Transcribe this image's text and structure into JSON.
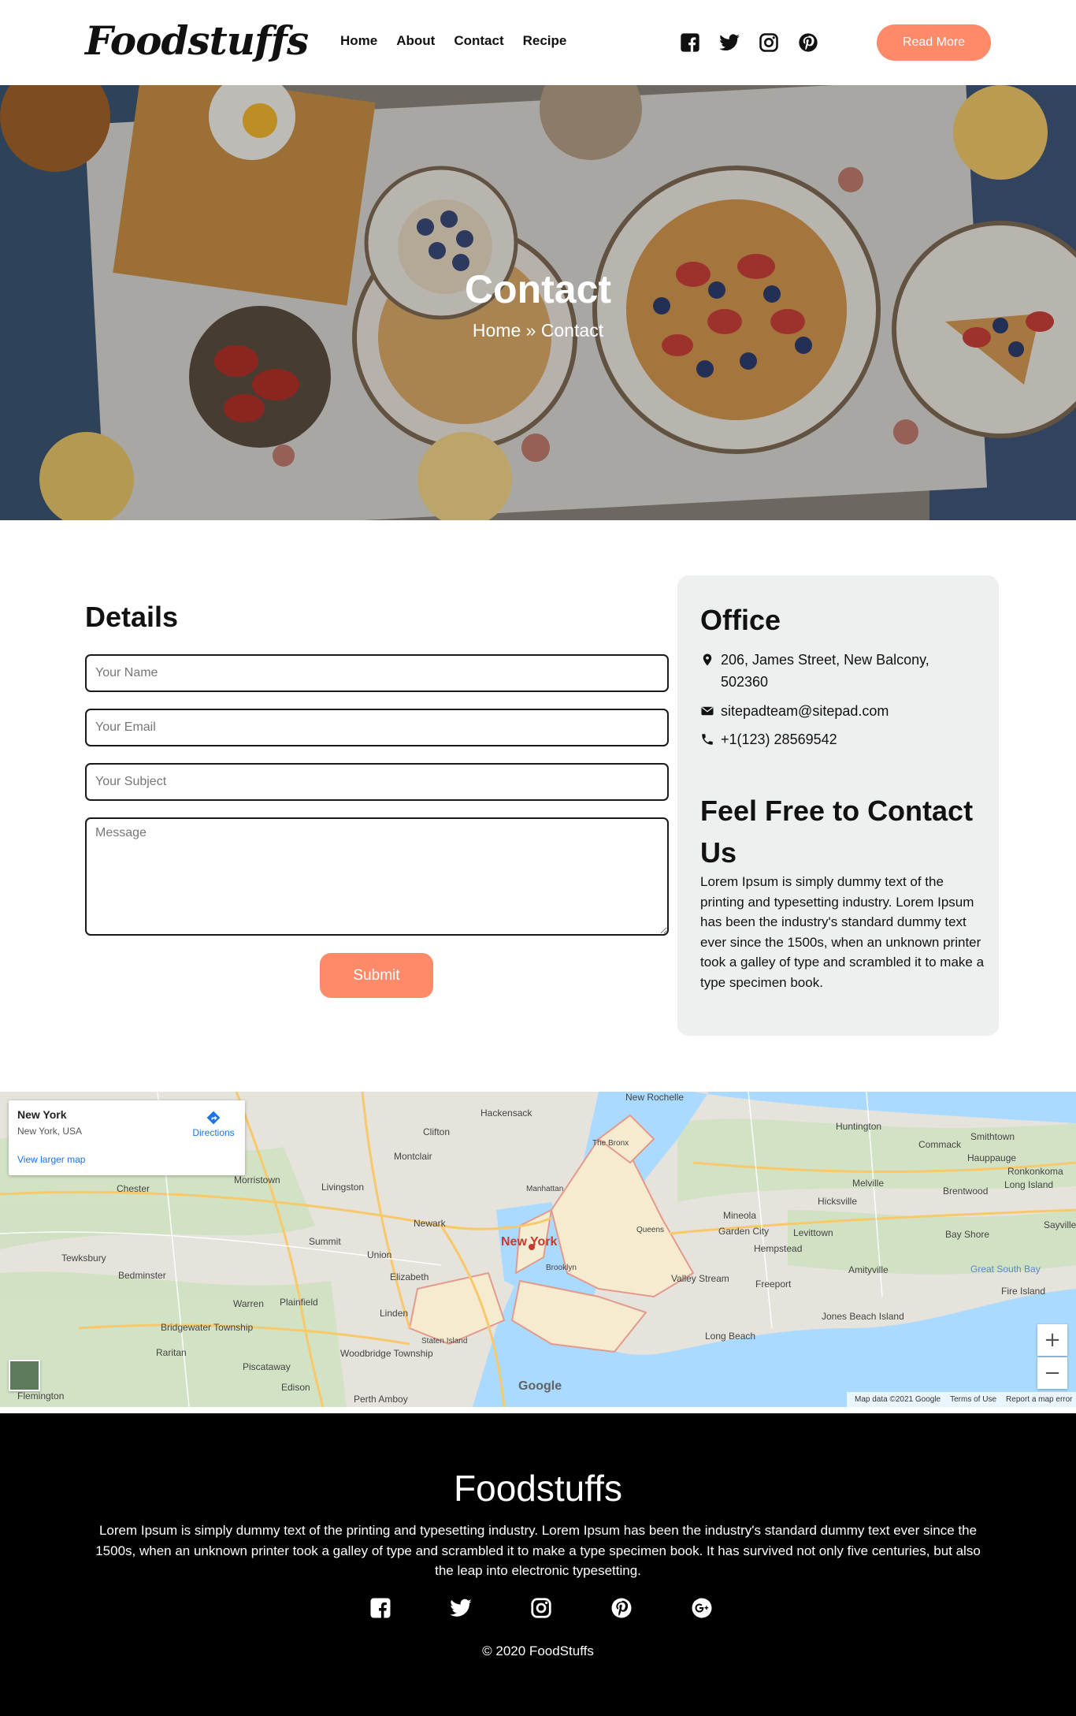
{
  "header": {
    "logo": "Foodstuffs",
    "nav": [
      "Home",
      "About",
      "Contact",
      "Recipe"
    ],
    "socials": [
      "facebook-icon",
      "twitter-icon",
      "instagram-icon",
      "pinterest-icon"
    ],
    "read_more": "Read More"
  },
  "hero": {
    "title": "Contact",
    "breadcrumb": "Home » Contact"
  },
  "form": {
    "title": "Details",
    "name_placeholder": "Your Name",
    "email_placeholder": "Your Email",
    "subject_placeholder": "Your Subject",
    "message_placeholder": "Message",
    "submit": "Submit"
  },
  "office": {
    "title": "Office",
    "address": "206, James Street, New Balcony, 502360",
    "email": "sitepadteam@sitepad.com",
    "phone": "+1(123) 28569542",
    "contact_title": "Feel Free to Contact Us",
    "contact_text": "Lorem Ipsum is simply dummy text of the printing and typesetting industry. Lorem Ipsum has been the industry's standard dummy text ever since the 1500s, when an unknown printer took a galley of type and scrambled it to make a type specimen book."
  },
  "map": {
    "place_title": "New York",
    "place_subtitle": "New York, USA",
    "larger_map": "View larger map",
    "directions": "Directions",
    "city_label": "New York",
    "labels": [
      "Hackensack",
      "Clifton",
      "Montclair",
      "Newark",
      "Union",
      "Elizabeth",
      "Summit",
      "Livingston",
      "Morristown",
      "Chester",
      "Tewksbury",
      "Bedminster",
      "Bridgewater Township",
      "Plainfield",
      "Edison",
      "Woodbridge Township",
      "Staten Island",
      "Brooklyn",
      "Queens",
      "Manhattan",
      "The Bronx",
      "Hempstead",
      "Garden City",
      "Mineola",
      "Levittown",
      "Hicksville",
      "Melville",
      "Huntington",
      "Commack",
      "Smithtown",
      "Hauppauge",
      "Brentwood",
      "Bay Shore",
      "Amityville",
      "Freeport",
      "Long Beach",
      "Jones Beach Island",
      "Valley Stream",
      "Long Island",
      "New Rochelle",
      "Perth Amboy",
      "Flemington",
      "Warren",
      "Linden",
      "Raritan",
      "Piscataway",
      "Fire Island",
      "Ronkonkoma",
      "Sayville",
      "Great South Bay"
    ],
    "zoom_in": "+",
    "zoom_out": "−",
    "google": "Google",
    "attribution": [
      "Map data ©2021 Google",
      "Terms of Use",
      "Report a map error"
    ]
  },
  "footer": {
    "title": "Foodstuffs",
    "text": "Lorem Ipsum is simply dummy text of the printing and typesetting industry. Lorem Ipsum has been the industry's standard dummy text ever since the 1500s, when an unknown printer took a galley of type and scrambled it to make a type specimen book. It has survived not only five centuries, but also the leap into electronic typesetting.",
    "socials": [
      "facebook-icon",
      "twitter-icon",
      "instagram-icon",
      "pinterest-icon",
      "google-plus-icon"
    ],
    "copyright": "© 2020 FoodStuffs"
  },
  "colors": {
    "accent": "#fe8a6a",
    "card": "#eef0ef",
    "footer": "#000000"
  }
}
